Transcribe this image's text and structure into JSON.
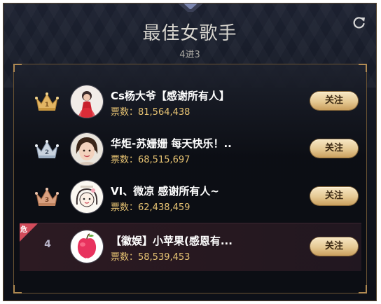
{
  "header": {
    "title": "最佳女歌手",
    "round": "4进3"
  },
  "icons": {
    "refresh": "refresh-icon",
    "crown": "crown-icon",
    "danger": "danger-badge"
  },
  "colors": {
    "gold": "#e5c892",
    "crown_gold": "#e2b564",
    "crown_silver": "#c9d3df",
    "crown_bronze": "#d9a080",
    "vote_text": "#e6c272",
    "danger_red": "#d24b5a"
  },
  "ranking": [
    {
      "rank": "1",
      "name": "Cs杨大爷【感谢所有人】",
      "votes_label": "票数：81,564,438",
      "follow_label": "关注",
      "crown": "gold"
    },
    {
      "rank": "2",
      "name": "华炬-苏姗姗 每天快乐！..",
      "votes_label": "票数：68,515,697",
      "follow_label": "关注",
      "crown": "silver"
    },
    {
      "rank": "3",
      "name": "VI、微凉 感谢所有人~",
      "votes_label": "票数：62,438,459",
      "follow_label": "关注",
      "crown": "bronze"
    },
    {
      "rank": "4",
      "name": "【徽娱】小苹果(感恩有...",
      "votes_label": "票数：58,539,453",
      "follow_label": "关注",
      "danger_label": "危"
    }
  ]
}
